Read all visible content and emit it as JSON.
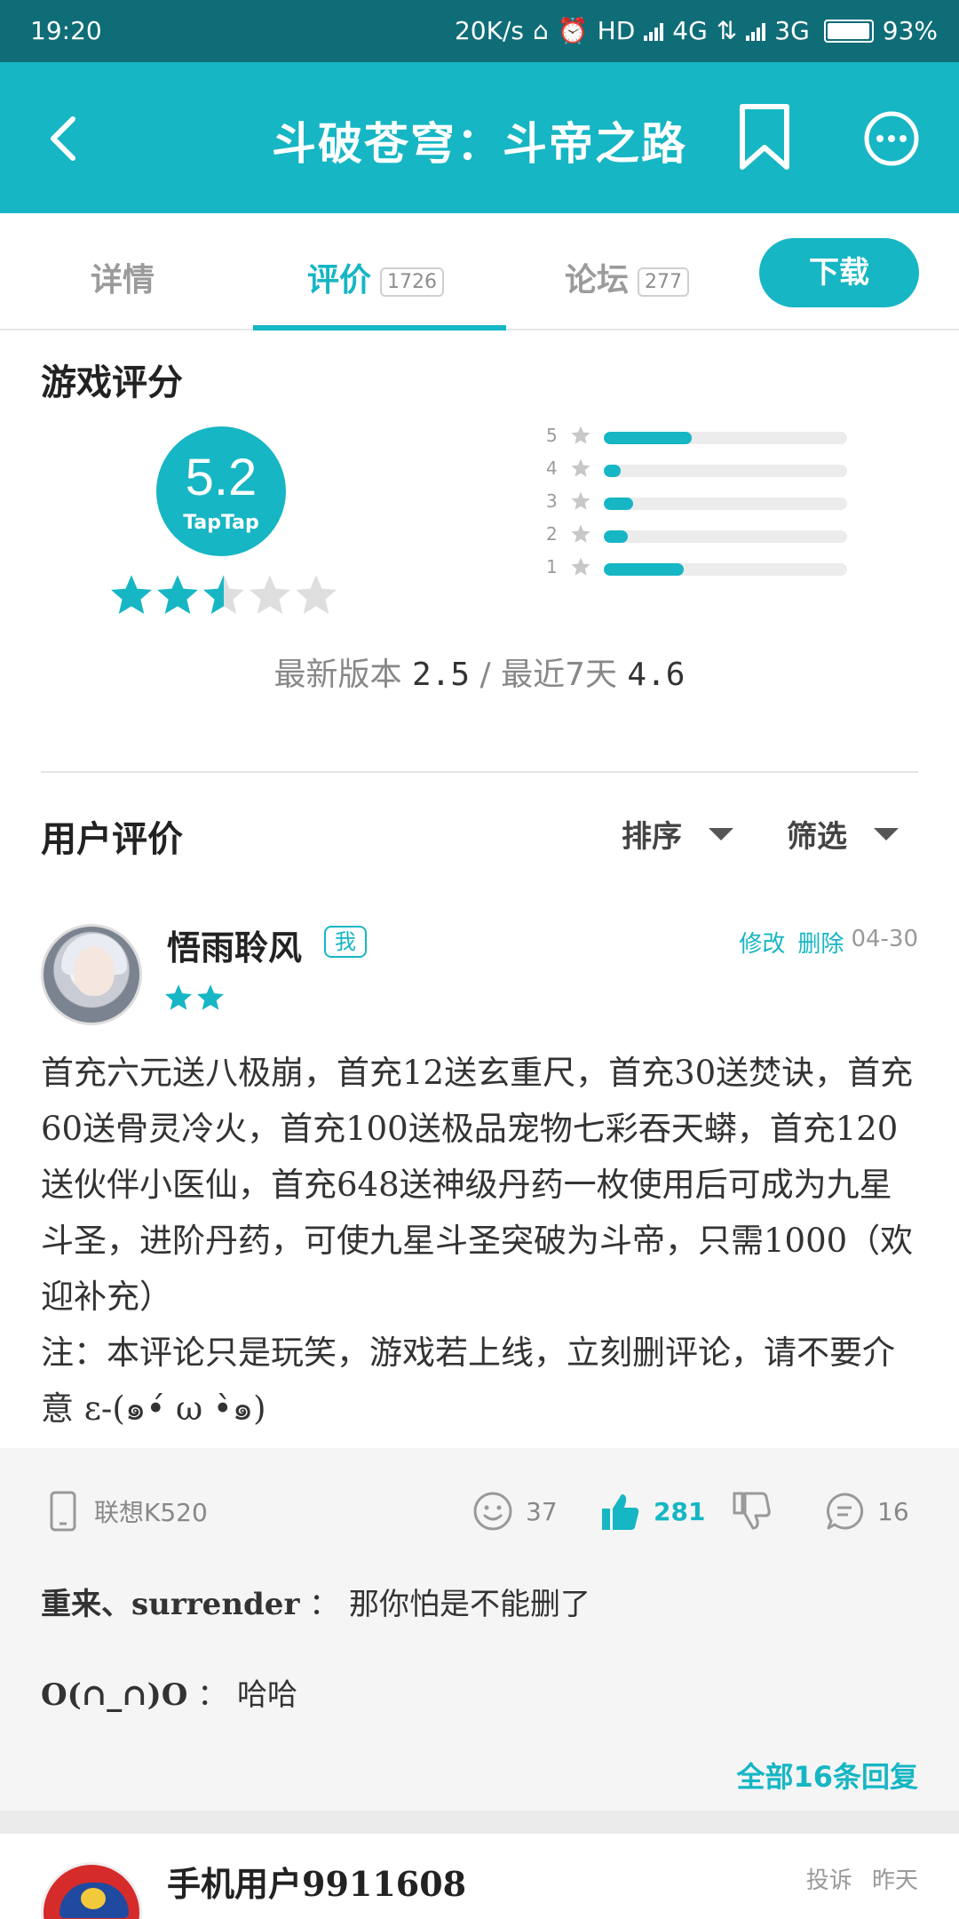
{
  "status_bar": {
    "time": "19:20",
    "speed": "20K/s",
    "hd": "HD",
    "net1": "4G",
    "net2": "3G",
    "battery": "93%"
  },
  "header": {
    "title": "斗破苍穹：斗帝之路"
  },
  "tabs": [
    {
      "label": "详情",
      "count": ""
    },
    {
      "label": "评价",
      "count": "1726"
    },
    {
      "label": "论坛",
      "count": "277"
    }
  ],
  "download_label": "下载",
  "score_section": {
    "title": "游戏评分",
    "score": "5.2",
    "brand": "TapTap",
    "stars_value": 2.5,
    "distribution": [
      {
        "label": "5",
        "fraction": 0.36
      },
      {
        "label": "4",
        "fraction": 0.07
      },
      {
        "label": "3",
        "fraction": 0.12
      },
      {
        "label": "2",
        "fraction": 0.1
      },
      {
        "label": "1",
        "fraction": 0.33
      }
    ],
    "latest_version_label": "最新版本",
    "latest_version_value": "2.5",
    "separator": " / ",
    "recent_label": "最近7天",
    "recent_value": "4.6"
  },
  "reviews_header": {
    "title": "用户评价",
    "sort_label": "排序",
    "filter_label": "筛选"
  },
  "review": {
    "username": "悟雨聆风",
    "me_badge": "我",
    "edit_label": "修改",
    "delete_label": "删除",
    "date": "04-30",
    "stars": 2,
    "text": "首充六元送八极崩，首充12送玄重尺，首充30送焚诀，首充60送骨灵冷火，首充100送极品宠物七彩吞天蟒，首充120送伙伴小医仙，首充648送神级丹药一枚使用后可成为九星斗圣，进阶丹药，可使九星斗圣突破为斗帝，只需1000（欢迎补充）\n注：本评论只是玩笑，游戏若上线，立刻删评论，请不要介意 ε-(๑•́ ω •̀๑)",
    "device": "联想K520",
    "funny_count": "37",
    "like_count": "281",
    "comment_count": "16",
    "replies": [
      {
        "user": "重来、surrender",
        "sep": " ：",
        "text": "那你怕是不能删了"
      },
      {
        "user": "O(∩_∩)O",
        "sep": " ：",
        "text": "哈哈"
      }
    ],
    "all_replies_label": "全部16条回复"
  },
  "review2": {
    "username": "手机用户9911608",
    "report_label": "投诉",
    "date": "昨天"
  },
  "colors": {
    "accent": "#16b6c4",
    "status_bar": "#0f6d78"
  }
}
